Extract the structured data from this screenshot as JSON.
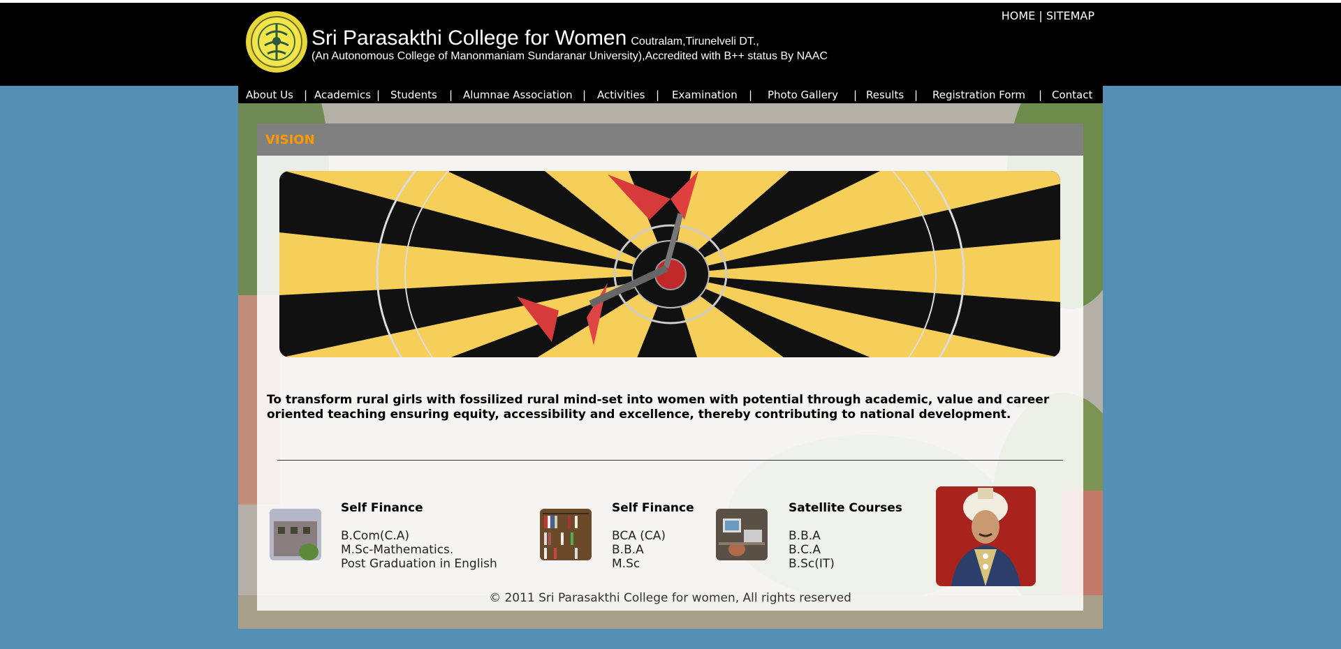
{
  "header": {
    "college_name": "Sri Parasakthi College for Women",
    "location": "Coutralam,Tirunelveli DT.,",
    "subtitle": "(An Autonomous College of Manonmaniam Sundaranar University),Accredited with B++ status By NAAC",
    "links": {
      "home": "HOME",
      "separator": "|",
      "sitemap": "SITEMAP"
    }
  },
  "nav": {
    "items": [
      "About Us",
      "Academics",
      "Students",
      "Alumnae Association",
      "Activities",
      "Examination",
      "Photo Gallery",
      "Results",
      "Registration Form",
      "Contact"
    ],
    "separator": "|"
  },
  "vision": {
    "title": "VISION",
    "text": "To transform rural girls with fossilized rural mind-set into women with potential through academic, value and career oriented teaching ensuring equity, accessibility and excellence, thereby contributing to national development."
  },
  "courses": [
    {
      "title": "Self Finance",
      "lines": [
        "B.Com(C.A)",
        "M.Sc-Mathematics.",
        "Post Graduation in English"
      ]
    },
    {
      "title": "Self Finance",
      "lines": [
        "BCA (CA)",
        "B.B.A",
        "M.Sc"
      ]
    },
    {
      "title": "Satellite Courses",
      "lines": [
        "B.B.A",
        "B.C.A",
        "B.Sc(IT)"
      ]
    }
  ],
  "footer": {
    "text": "© 2011 Sri Parasakthi College for women, All rights reserved"
  },
  "colors": {
    "accent": "#ff9900",
    "page_bg": "#568fb4",
    "header_bg": "#000000",
    "vision_bar": "#808080"
  }
}
